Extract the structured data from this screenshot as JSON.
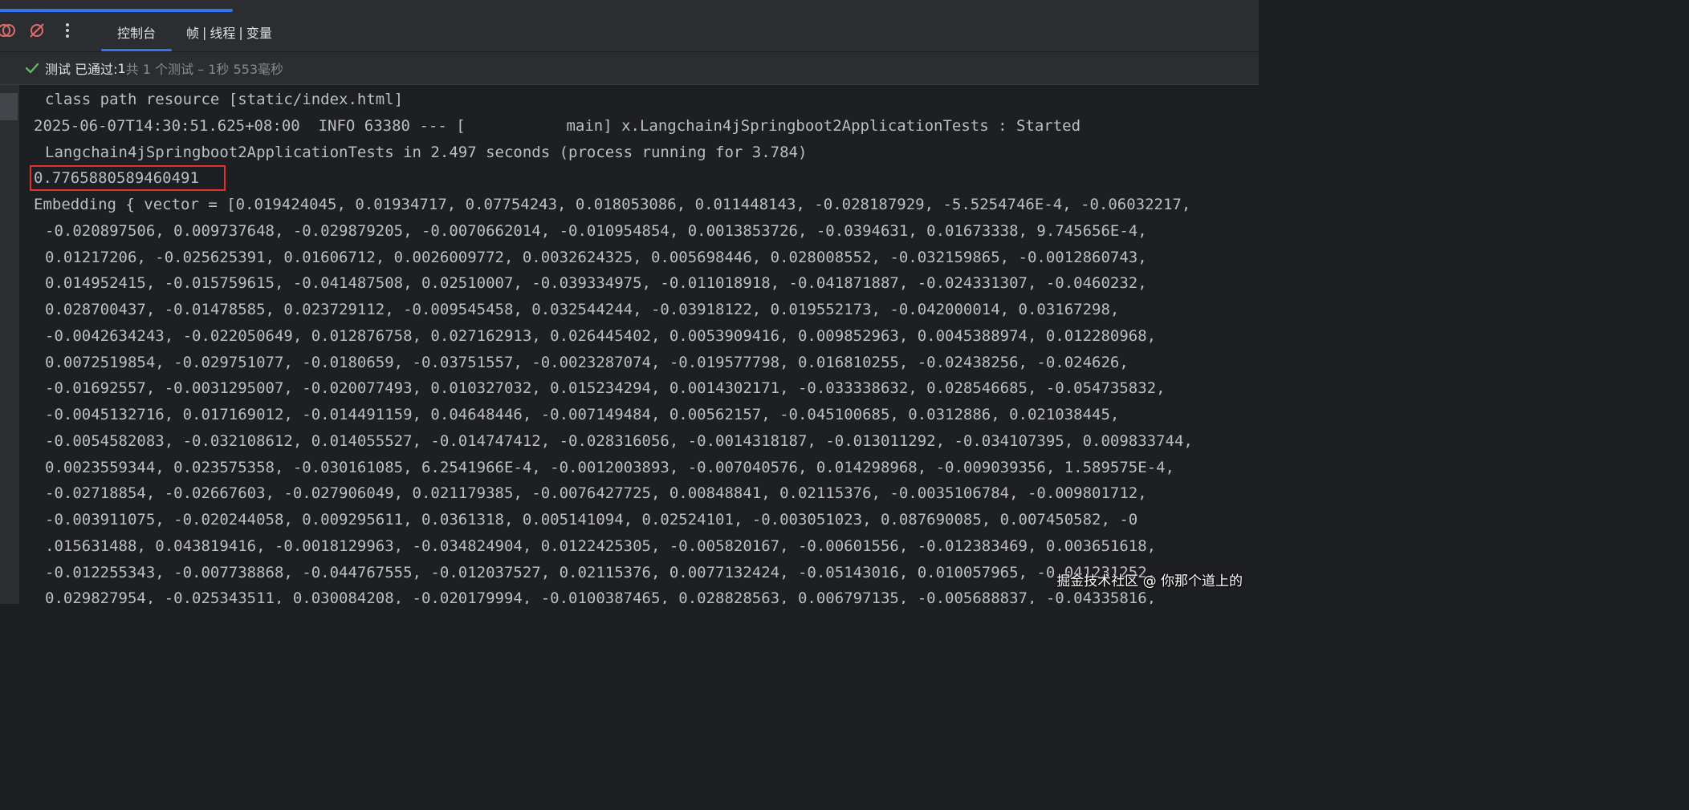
{
  "toolbar": {
    "tab_console": "控制台",
    "tab_frames": "帧",
    "tab_threads": "线程",
    "tab_variables": "变量",
    "separator": "|"
  },
  "progress": {
    "fraction": 0.185
  },
  "status": {
    "passed": "测试 已通过:",
    "count": " 1",
    "detail": "共 1 个测试 – 1秒 553毫秒"
  },
  "icons": [
    "restart-icon",
    "mute-breakpoints-icon",
    "more-options-icon",
    "check-icon"
  ],
  "colors": {
    "accent": "#3574f0",
    "success": "#5fb865",
    "highlight_box": "#e0312a",
    "console_bg": "#1e1f22",
    "console_text": "#bcbec4"
  },
  "console": {
    "lines": [
      "class path resource [static/index.html]",
      "2025-06-07T14:30:51.625+08:00  INFO 63380 --- [           main] x.Langchain4jSpringboot2ApplicationTests : Started",
      "Langchain4jSpringboot2ApplicationTests in 2.497 seconds (process running for 3.784)",
      "0.7765880589460491",
      "Embedding { vector = [0.019424045, 0.01934717, 0.07754243, 0.018053086, 0.011448143, -0.028187929, -5.5254746E-4, -0.06032217,",
      "-0.020897506, 0.009737648, -0.029879205, -0.0070662014, -0.010954854, 0.0013853726, -0.0394631, 0.01673338, 9.745656E-4,",
      "0.01217206, -0.025625391, 0.01606712, 0.0026009772, 0.0032624325, 0.005698446, 0.028008552, -0.032159865, -0.0012860743,",
      "0.014952415, -0.015759615, -0.041487508, 0.02510007, -0.039334975, -0.011018918, -0.041871887, -0.024331307, -0.0460232,",
      "0.028700437, -0.01478585, 0.023729112, -0.009545458, 0.032544244, -0.03918122, 0.019552173, -0.042000014, 0.03167298,",
      "-0.0042634243, -0.022050649, 0.012876758, 0.027162913, 0.026445402, 0.0053909416, 0.009852963, 0.0045388974, 0.012280968,",
      "0.0072519854, -0.029751077, -0.0180659, -0.03751557, -0.0023287074, -0.019577798, 0.016810255, -0.02438256, -0.024626,",
      "-0.01692557, -0.0031295007, -0.020077493, 0.010327032, 0.015234294, 0.0014302171, -0.033338632, 0.028546685, -0.054735832,",
      "-0.0045132716, 0.017169012, -0.014491159, 0.04648446, -0.007149484, 0.00562157, -0.045100685, 0.0312886, 0.021038445,",
      "-0.0054582083, -0.032108612, 0.014055527, -0.014747412, -0.028316056, -0.0014318187, -0.013011292, -0.034107395, 0.009833744,",
      "0.0023559344, 0.023575358, -0.030161085, 6.2541966E-4, -0.0012003893, -0.007040576, 0.014298968, -0.009039356, 1.589575E-4,",
      "-0.02718854, -0.02667603, -0.027906049, 0.021179385, -0.0076427725, 0.00848841, 0.02115376, -0.0035106784, -0.009801712,",
      "-0.003911075, -0.020244058, 0.009295611, 0.0361318, 0.005141094, 0.02524101, -0.003051023, 0.087690085, 0.007450582, -0",
      ".015631488, 0.043819416, -0.0018129963, -0.034824904, 0.0122425305, -0.005820167, -0.00601556, -0.012383469, 0.003651618,",
      "-0.012255343, -0.007738868, -0.044767555, -0.012037527, 0.02115376, 0.0077132424, -0.05143016, 0.010057965, -0.041231252,",
      "0.029827954, -0.025343511, 0.030084208, -0.020179994, -0.0100387465, 0.028828563, 0.006797135, -0.005688837, -0.04335816,"
    ]
  },
  "watermark": "掘金技术社区 @ 你那个道上的"
}
